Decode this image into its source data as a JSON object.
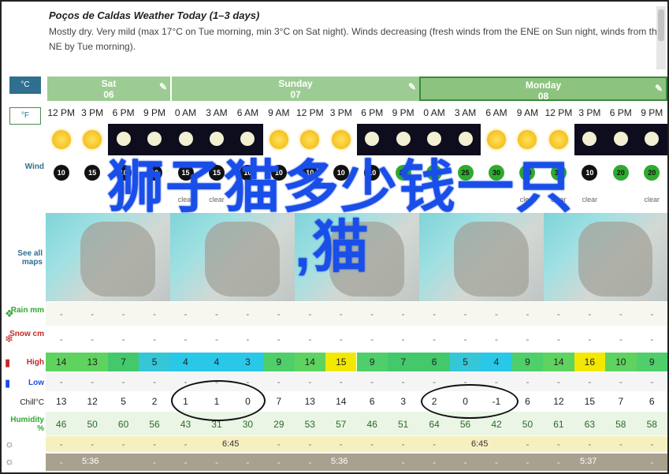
{
  "header": {
    "title": "Poços de Caldas Weather Today (1–3 days)",
    "summary": "Mostly dry. Very mild (max 17°C on Tue morning, min 3°C on Sat night). Winds decreasing (fresh winds from the ENE on Sun night, winds from the NE by Tue morning)."
  },
  "units": {
    "celsius": "°C",
    "fahrenheit": "°F"
  },
  "days": [
    {
      "name": "Sat",
      "date": "06"
    },
    {
      "name": "Sunday",
      "date": "07"
    },
    {
      "name": "Monday",
      "date": "08"
    }
  ],
  "labels": {
    "wind": "Wind",
    "see_all_maps": "See all maps",
    "rain": "Rain mm",
    "snow": "Snow cm",
    "high": "High",
    "low": "Low",
    "chill": "Chill°C",
    "humidity": "Humidity %"
  },
  "times": [
    "12 PM",
    "3 PM",
    "6 PM",
    "9 PM",
    "0 AM",
    "3 AM",
    "6 AM",
    "9 AM",
    "12 PM",
    "3 PM",
    "6 PM",
    "9 PM",
    "0 AM",
    "3 AM",
    "6 AM",
    "9 AM",
    "12 PM",
    "3 PM",
    "6 PM",
    "9 PM"
  ],
  "sky": [
    "sun",
    "sun",
    "moon",
    "moon",
    "moon",
    "moon",
    "moon",
    "sun",
    "sun",
    "sun",
    "moon",
    "moon",
    "moon",
    "moon",
    "sun",
    "sun",
    "sun",
    "moon",
    "moon",
    "moon"
  ],
  "wind": [
    {
      "v": "10",
      "g": false
    },
    {
      "v": "15",
      "g": false
    },
    {
      "v": "10",
      "g": false
    },
    {
      "v": "10",
      "g": false
    },
    {
      "v": "15",
      "g": false
    },
    {
      "v": "15",
      "g": false
    },
    {
      "v": "10",
      "g": false
    },
    {
      "v": "10",
      "g": false
    },
    {
      "v": "10",
      "g": false
    },
    {
      "v": "10",
      "g": false
    },
    {
      "v": "10",
      "g": false
    },
    {
      "v": "25",
      "g": true
    },
    {
      "v": "25",
      "g": true
    },
    {
      "v": "25",
      "g": true
    },
    {
      "v": "30",
      "g": true
    },
    {
      "v": "30",
      "g": true
    },
    {
      "v": "30",
      "g": true
    },
    {
      "v": "10",
      "g": false
    },
    {
      "v": "20",
      "g": true
    },
    {
      "v": "20",
      "g": true
    }
  ],
  "conditions": [
    "",
    "",
    "",
    "",
    "clear",
    "clear",
    "",
    "",
    "",
    "",
    "",
    "",
    "",
    "",
    "",
    "clear",
    "clear",
    "clear",
    "",
    "clear"
  ],
  "high": [
    {
      "v": "14",
      "c": "#5fd35f"
    },
    {
      "v": "13",
      "c": "#5fd35f"
    },
    {
      "v": "7",
      "c": "#43c96b"
    },
    {
      "v": "5",
      "c": "#35c6d8"
    },
    {
      "v": "4",
      "c": "#29c7e8"
    },
    {
      "v": "4",
      "c": "#29c7e8"
    },
    {
      "v": "3",
      "c": "#29c7e8"
    },
    {
      "v": "9",
      "c": "#4ecf6a"
    },
    {
      "v": "14",
      "c": "#5fd35f"
    },
    {
      "v": "15",
      "c": "#f2e800"
    },
    {
      "v": "9",
      "c": "#4ecf6a"
    },
    {
      "v": "7",
      "c": "#43c96b"
    },
    {
      "v": "6",
      "c": "#43c96b"
    },
    {
      "v": "5",
      "c": "#35c6d8"
    },
    {
      "v": "4",
      "c": "#29c7e8"
    },
    {
      "v": "9",
      "c": "#4ecf6a"
    },
    {
      "v": "14",
      "c": "#5fd35f"
    },
    {
      "v": "16",
      "c": "#f2e800"
    },
    {
      "v": "10",
      "c": "#5fd35f"
    },
    {
      "v": "9",
      "c": "#4ecf6a"
    }
  ],
  "chill": [
    "13",
    "12",
    "5",
    "2",
    "1",
    "1",
    "0",
    "7",
    "13",
    "14",
    "6",
    "3",
    "2",
    "0",
    "-1",
    "6",
    "12",
    "15",
    "7",
    "6"
  ],
  "humidity": [
    "46",
    "50",
    "60",
    "56",
    "43",
    "31",
    "30",
    "29",
    "53",
    "57",
    "46",
    "51",
    "64",
    "56",
    "42",
    "50",
    "61",
    "63",
    "58",
    "58"
  ],
  "sunrise": [
    "6:45",
    "6:45"
  ],
  "sunset": [
    "5:36",
    "5:36",
    "5:37"
  ],
  "overlay": {
    "line1": "狮子猫多少钱一只",
    "line2": ",猫"
  }
}
